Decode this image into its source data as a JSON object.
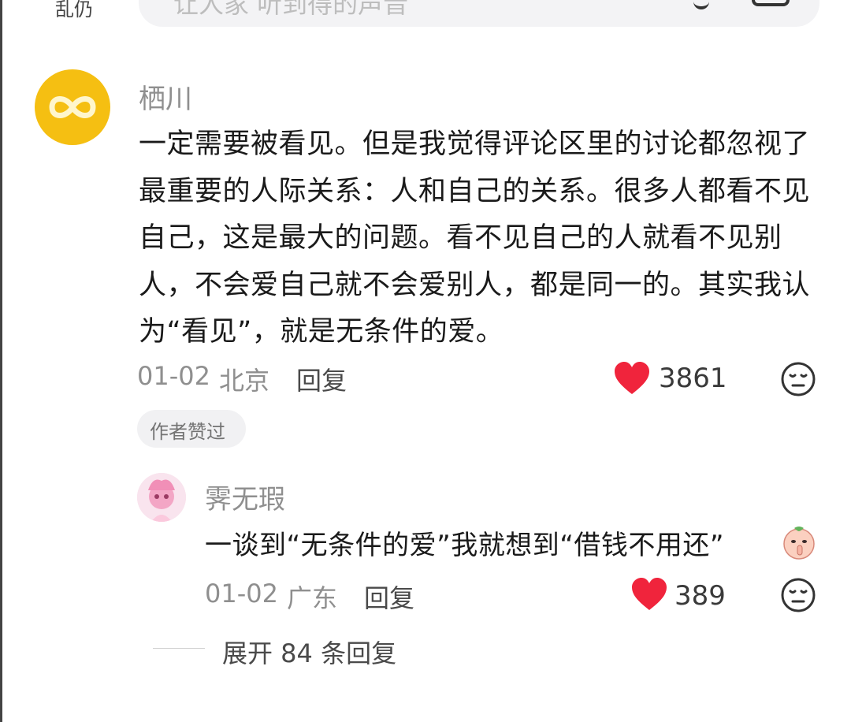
{
  "top_bar": {
    "input_placeholder": "让人家 听到得的声音",
    "corner_text": "乱仍"
  },
  "comment": {
    "author": "栖川",
    "text": "一定需要被看见。但是我觉得评论区里的讨论都忽视了最重要的人际关系：人和自己的关系。很多人都看不见自己，这是最大的问题。看不见自己的人就看不见别人，不会爱自己就不会爱别人，都是同一的。其实我认为“看见”，就是无条件的爱。",
    "date": "01-02",
    "location": "北京",
    "reply_label": "回复",
    "likes": "3861",
    "badge": "作者赞过",
    "icons": {
      "like": "heart-icon",
      "dislike": "meh-face-icon",
      "avatar": "infinity-icon"
    },
    "accent": "#f5bf12",
    "like_color": "#f0243c"
  },
  "reply": {
    "author": "霁无瑕",
    "text": "一谈到“无条件的爱”我就想到“借钱不用还”",
    "date": "01-02",
    "location": "广东",
    "reply_label": "回复",
    "likes": "389",
    "emoji": "shush-face-emoji"
  },
  "expand": {
    "label": "展开 84 条回复"
  }
}
